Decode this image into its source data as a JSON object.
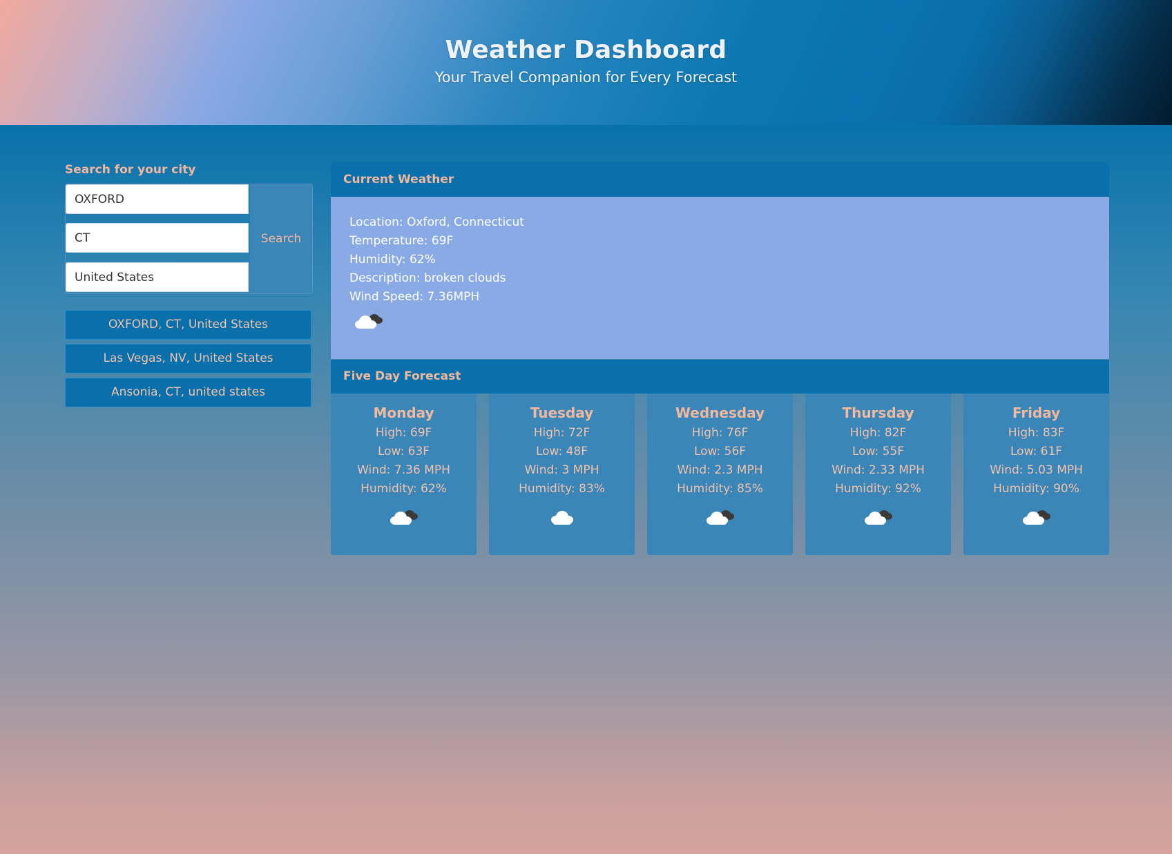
{
  "header": {
    "title": "Weather Dashboard",
    "subtitle": "Your Travel Companion for Every Forecast"
  },
  "search": {
    "title": "Search for your city",
    "city_value": "OXFORD",
    "state_value": "CT",
    "country_value": "United States",
    "button_label": "Search"
  },
  "history": [
    "OXFORD, CT, United States",
    "Las Vegas, NV, United States",
    "Ansonia, CT, united states"
  ],
  "current": {
    "title": "Current Weather",
    "location": "Location: Oxford, Connecticut",
    "temperature": "Temperature: 69F",
    "humidity": "Humidity: 62%",
    "description": "Description: broken clouds",
    "wind": "Wind Speed: 7.36MPH",
    "icon": "broken-clouds-icon"
  },
  "forecast": {
    "title": "Five Day Forecast",
    "days": [
      {
        "name": "Monday",
        "high": "High: 69F",
        "low": "Low: 63F",
        "wind": "Wind: 7.36 MPH",
        "humidity": "Humidity: 62%",
        "icon": "broken-clouds-icon"
      },
      {
        "name": "Tuesday",
        "high": "High: 72F",
        "low": "Low: 48F",
        "wind": "Wind: 3 MPH",
        "humidity": "Humidity: 83%",
        "icon": "cloud-icon"
      },
      {
        "name": "Wednesday",
        "high": "High: 76F",
        "low": "Low: 56F",
        "wind": "Wind: 2.3 MPH",
        "humidity": "Humidity: 85%",
        "icon": "broken-clouds-icon"
      },
      {
        "name": "Thursday",
        "high": "High: 82F",
        "low": "Low: 55F",
        "wind": "Wind: 2.33 MPH",
        "humidity": "Humidity: 92%",
        "icon": "broken-clouds-icon"
      },
      {
        "name": "Friday",
        "high": "High: 83F",
        "low": "Low: 61F",
        "wind": "Wind: 5.03 MPH",
        "humidity": "Humidity: 90%",
        "icon": "broken-clouds-icon"
      }
    ]
  },
  "colors": {
    "accent_text": "#f0b89e",
    "panel_blue": "#0a70ac",
    "current_bg": "#8aaae6",
    "card_bg": "#3a86b8"
  }
}
